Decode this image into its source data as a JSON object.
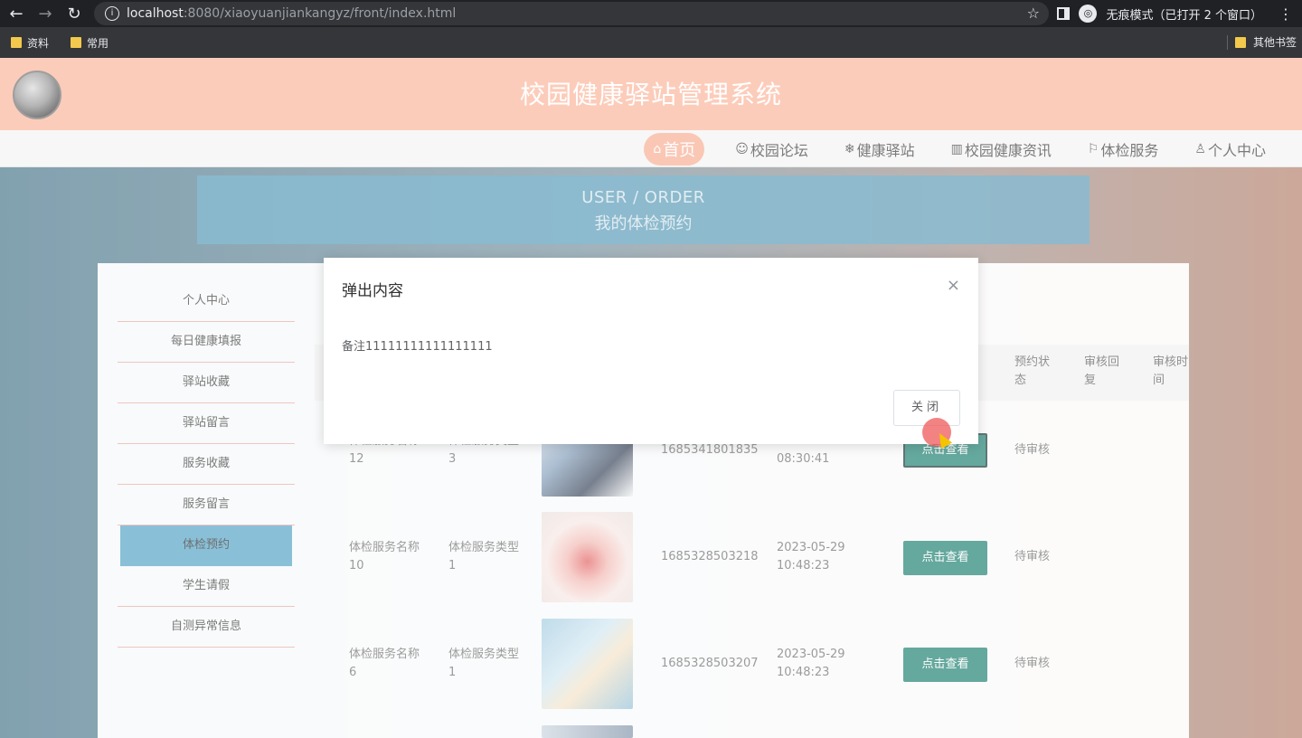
{
  "browser": {
    "url_host": "localhost",
    "url_path": ":8080/xiaoyuanjiankangyz/front/index.html",
    "incognito_text": "无痕模式（已打开 2 个窗口）",
    "bookmarks": [
      "资料",
      "常用"
    ],
    "other_bookmarks": "其他书签"
  },
  "site": {
    "title": "校园健康驿站管理系统",
    "nav": [
      {
        "label": "首页",
        "icon": "⌂"
      },
      {
        "label": "校园论坛",
        "icon": "☺"
      },
      {
        "label": "健康驿站",
        "icon": "❄"
      },
      {
        "label": "校园健康资讯",
        "icon": "▥"
      },
      {
        "label": "体检服务",
        "icon": "⚐"
      },
      {
        "label": "个人中心",
        "icon": "♙"
      }
    ],
    "active_nav": "首页"
  },
  "banner": {
    "en": "USER / ORDER",
    "cn": "我的体检预约"
  },
  "side_menu": [
    "个人中心",
    "每日健康填报",
    "驿站收藏",
    "驿站留言",
    "服务收藏",
    "服务留言",
    "体检预约",
    "学生请假",
    "自测异常信息"
  ],
  "active_menu": "体检预约",
  "table": {
    "headers": [
      "预约状态",
      "审核回复",
      "审核时间"
    ],
    "rows": [
      {
        "name": "体检服务名称12",
        "type": "体检服务类型3",
        "code": "1685341801835",
        "time": "2023-05-30 08:30:41",
        "button": "点击查看",
        "status": "待审核"
      },
      {
        "name": "体检服务名称10",
        "type": "体检服务类型1",
        "code": "1685328503218",
        "time": "2023-05-29 10:48:23",
        "button": "点击查看",
        "status": "待审核"
      },
      {
        "name": "体检服务名称6",
        "type": "体检服务类型1",
        "code": "1685328503207",
        "time": "2023-05-29 10:48:23",
        "button": "点击查看",
        "status": "待审核"
      }
    ]
  },
  "modal": {
    "title": "弹出内容",
    "body": "备注11111111111111111",
    "close_button": "关闭",
    "close_icon": "×"
  },
  "colors": {
    "header_bg": "#fbb195",
    "accent_button": "#137a6a",
    "active_menu": "#4a9fc4"
  }
}
